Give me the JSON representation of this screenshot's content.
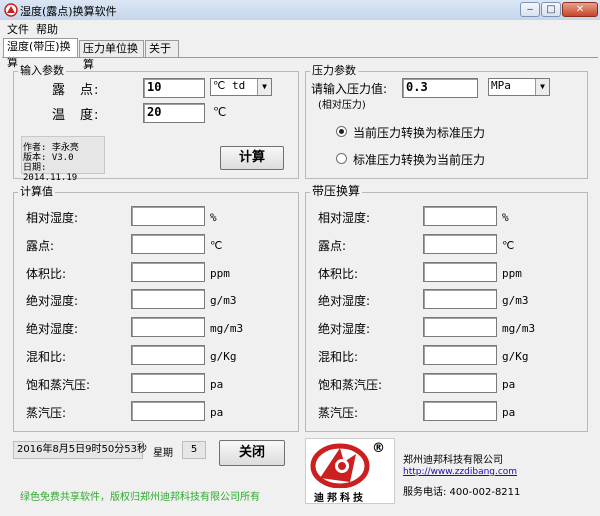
{
  "window": {
    "title": "湿度(露点)换算软件",
    "minimize": "‒",
    "maximize": "□",
    "close": "✕"
  },
  "menu": {
    "items": [
      "文件",
      "帮助"
    ]
  },
  "tabs": [
    "湿度(带压)换算",
    "压力单位换算",
    "关于"
  ],
  "input_params": {
    "title": "输入参数",
    "dewpoint_label": "露　点:",
    "dewpoint_value": "10",
    "dewpoint_unit": "℃ td",
    "temp_label": "温　度:",
    "temp_value": "20",
    "temp_unit": "℃",
    "author_line": "作者: 李永亮",
    "version_line": "版本: V3.0",
    "date_line": "日期: 2014.11.19",
    "calc_button": "计算"
  },
  "pressure_params": {
    "title": "压力参数",
    "input_label": "请输入压力值:",
    "sub_label": "(相对压力)",
    "value": "0.3",
    "unit": "MPa",
    "option1": "当前压力转换为标准压力",
    "option2": "标准压力转换为当前压力",
    "selected_option": 1
  },
  "calc_values": {
    "title": "计算值",
    "rows": [
      {
        "label": "相对湿度:",
        "unit": "%"
      },
      {
        "label": "露点:",
        "unit": "℃"
      },
      {
        "label": "体积比:",
        "unit": "ppm"
      },
      {
        "label": "绝对湿度:",
        "unit": "g/m3"
      },
      {
        "label": "绝对湿度:",
        "unit": "mg/m3"
      },
      {
        "label": "混和比:",
        "unit": "g/Kg"
      },
      {
        "label": "饱和蒸汽压:",
        "unit": "pa"
      },
      {
        "label": "蒸汽压:",
        "unit": "pa"
      }
    ]
  },
  "pressure_calc": {
    "title": "带压换算",
    "rows": [
      {
        "label": "相对湿度:",
        "unit": "%"
      },
      {
        "label": "露点:",
        "unit": "℃"
      },
      {
        "label": "体积比:",
        "unit": "ppm"
      },
      {
        "label": "绝对湿度:",
        "unit": "g/m3"
      },
      {
        "label": "绝对湿度:",
        "unit": "mg/m3"
      },
      {
        "label": "混和比:",
        "unit": "g/Kg"
      },
      {
        "label": "饱和蒸汽压:",
        "unit": "pa"
      },
      {
        "label": "蒸汽压:",
        "unit": "pa"
      }
    ]
  },
  "status": {
    "datetime": "2016年8月5日9时50分53秒",
    "weekday_label": "星期",
    "weekday_value": "5",
    "close_button": "关闭"
  },
  "footer": {
    "notice": "绿色免费共享软件，版权归郑州迪邦科技有限公司所有",
    "logo_text": "迪邦科技",
    "registered": "®",
    "company": "郑州迪邦科技有限公司",
    "url": "http://www.zzdibang.com",
    "phone": "服务电话: 400-002-8211"
  },
  "colors": {
    "logo_red": "#cc1f1f",
    "notice_green": "#2eaa2e",
    "titlebar": "#c5d6ec"
  }
}
